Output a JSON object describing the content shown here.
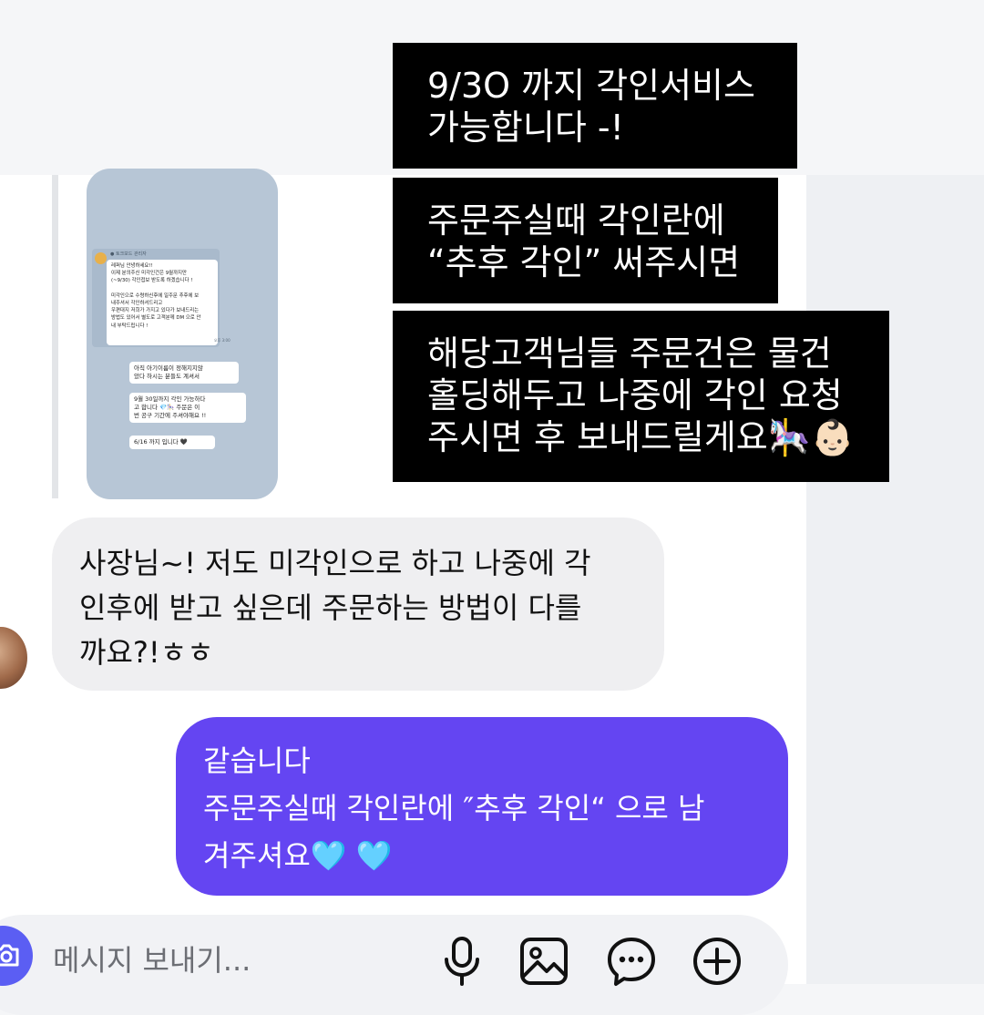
{
  "quoted_screenshot": {
    "sender": "● 토크보드 관리자",
    "announcement": "레퍼님 안녕하세요!!\n이제 분의주신 미각인건은 9월까지만\n(~9/30) 각인접보 받도록 하겠습니다 !\n\n미각인으로 수령하신후에 일주문 추후에 보\n내주셔서 각인하셔드리고\n우편대지 저희가 가지고 있다가 보내드리는\n방법도 있어서 별도로 고객분께 DM 으로 안\n내 부탁드립니다 !",
    "time": "오후 3:00",
    "msg_1": "아직 아기이름이 정해지지않\n았다 하시는 분들도 계셔서",
    "msg_2": "9월 30일까지 각인 가능하다\n고 합니다 💎🎠 주문은 이\n번 공구 기간에 주셔야해요 !!",
    "msg_3": "6/16 까지 입니다 🖤"
  },
  "info_blocks": [
    "9/3O 까지 각인서비스\n가능합니다 -!",
    "주문주실때 각인란에\n“추후 각인” 써주시면",
    "해당고객님들 주문건은 물건\n홀딩해두고 나중에 각인 요청\n주시면 후 보내드릴게요🎠👶🏻"
  ],
  "messages": {
    "received": "사장님~! 저도 미각인으로 하고 나중에 각\n인후에 받고 싶은데 주문하는 방법이 다를\n까요?!ㅎㅎ",
    "sent": "같습니다\n주문주실때 각인란에 ″추후 각인“ 으로 남\n겨주셔요🩵 🩵"
  },
  "composer": {
    "placeholder": "메시지 보내기..."
  },
  "icons": {
    "camera": "camera-icon",
    "mic": "microphone-icon",
    "gallery": "image-icon",
    "sticker": "sticker-chat-icon",
    "plus": "plus-circle-icon"
  },
  "colors": {
    "sent_bubble": "#6445f2",
    "received_bubble": "#efeff1",
    "camera_button": "#5b5ef3",
    "info_block": "#000000"
  }
}
